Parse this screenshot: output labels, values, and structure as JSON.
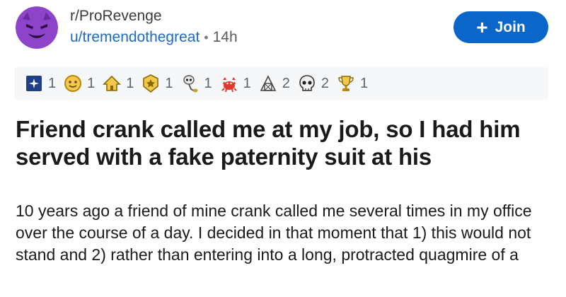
{
  "post": {
    "subreddit": "r/ProRevenge",
    "username": "u/tremendothegreat",
    "separator": "•",
    "time": "14h",
    "join_label": "Join",
    "title": "Friend crank called me at my job, so I had him served with a fake paternity suit at his",
    "body": "10  years ago a friend of mine crank called me several times in my office over the course of a day. I decided in that moment that 1) this would not stand and 2) rather than entering into a long, protracted quagmire of a"
  },
  "awards": [
    {
      "icon": "blue-square-award-icon",
      "count": "1"
    },
    {
      "icon": "gold-face-award-icon",
      "count": "1"
    },
    {
      "icon": "gold-house-award-icon",
      "count": "1"
    },
    {
      "icon": "gold-badge-award-icon",
      "count": "1"
    },
    {
      "icon": "alien-award-icon",
      "count": "1"
    },
    {
      "icon": "red-crab-award-icon",
      "count": "1"
    },
    {
      "icon": "sketch-award-icon",
      "count": "2"
    },
    {
      "icon": "skull-award-icon",
      "count": "2"
    },
    {
      "icon": "gold-trophy-award-icon",
      "count": "1"
    }
  ],
  "colors": {
    "accent": "#0a66c8",
    "link": "#1c6bc4",
    "award_bar": "#f6f7f8",
    "avatar": "#8e44c9"
  }
}
